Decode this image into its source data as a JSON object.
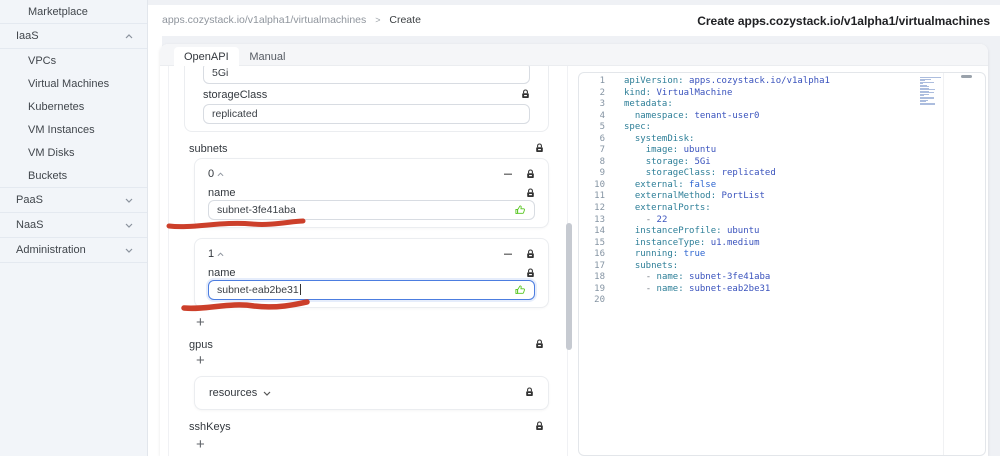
{
  "colors": {
    "focus_border": "#4c7de0",
    "like_green": "#52c41a",
    "annotation_red": "#c9351f",
    "yaml_key": "#2e7f98",
    "yaml_value": "#3a53bd",
    "yaml_boolean": "#2f66d0"
  },
  "icons": {
    "back": "arrow-left",
    "lock": "padlock",
    "like": "thumbs-up",
    "remove": "minus",
    "add": "plus",
    "expanded": "chevron-up",
    "collapsed": "chevron-down"
  },
  "sidebar": {
    "items": [
      {
        "label": "Marketplace",
        "level": 1,
        "chevron": null,
        "divider_after": true
      },
      {
        "label": "IaaS",
        "level": 0,
        "chevron": "up",
        "divider_after": true
      },
      {
        "label": "VPCs",
        "level": 1,
        "chevron": null,
        "divider_after": false
      },
      {
        "label": "Virtual Machines",
        "level": 1,
        "chevron": null,
        "divider_after": false
      },
      {
        "label": "Kubernetes",
        "level": 1,
        "chevron": null,
        "divider_after": false
      },
      {
        "label": "VM Instances",
        "level": 1,
        "chevron": null,
        "divider_after": false
      },
      {
        "label": "VM Disks",
        "level": 1,
        "chevron": null,
        "divider_after": false
      },
      {
        "label": "Buckets",
        "level": 1,
        "chevron": null,
        "divider_after": true
      },
      {
        "label": "PaaS",
        "level": 0,
        "chevron": "down",
        "divider_after": true
      },
      {
        "label": "NaaS",
        "level": 0,
        "chevron": "down",
        "divider_after": true
      },
      {
        "label": "Administration",
        "level": 0,
        "chevron": "down",
        "divider_after": true
      }
    ]
  },
  "header": {
    "breadcrumb": {
      "path": "apps.cozystack.io/v1alpha1/virtualmachines",
      "separator": ">",
      "current": "Create"
    },
    "back_icon": "←",
    "title": "Create apps.cozystack.io/v1alpha1/virtualmachines"
  },
  "tabs": [
    {
      "label": "OpenAPI",
      "active": true
    },
    {
      "label": "Manual",
      "active": false
    }
  ],
  "form": {
    "clipped_input_value": "5Gi",
    "storage_class": {
      "label": "storageClass",
      "value": "replicated"
    },
    "subnets": {
      "label": "subnets",
      "add_label": "+",
      "items": [
        {
          "index": "0",
          "field_label": "name",
          "value": "subnet-3fe41aba",
          "focused": false
        },
        {
          "index": "1",
          "field_label": "name",
          "value": "subnet-eab2be31",
          "focused": true
        }
      ]
    },
    "gpus": {
      "label": "gpus",
      "add_label": "+"
    },
    "resources": {
      "label": "resources"
    },
    "ssh_keys": {
      "label": "sshKeys",
      "add_label": "+"
    }
  },
  "editor": {
    "language": "yaml",
    "lines": [
      {
        "n": 1,
        "segs": [
          [
            "k",
            "apiVersion:"
          ],
          [
            "p",
            " "
          ],
          [
            "v",
            "apps.cozystack.io/v1alpha1"
          ]
        ]
      },
      {
        "n": 2,
        "segs": [
          [
            "k",
            "kind:"
          ],
          [
            "p",
            " "
          ],
          [
            "v",
            "VirtualMachine"
          ]
        ]
      },
      {
        "n": 3,
        "segs": [
          [
            "k",
            "metadata:"
          ]
        ]
      },
      {
        "n": 4,
        "segs": [
          [
            "p",
            "  "
          ],
          [
            "k",
            "namespace:"
          ],
          [
            "p",
            " "
          ],
          [
            "v",
            "tenant-user0"
          ]
        ]
      },
      {
        "n": 5,
        "segs": [
          [
            "k",
            "spec:"
          ]
        ]
      },
      {
        "n": 6,
        "segs": [
          [
            "p",
            "  "
          ],
          [
            "k",
            "systemDisk:"
          ]
        ]
      },
      {
        "n": 7,
        "segs": [
          [
            "p",
            "    "
          ],
          [
            "k",
            "image:"
          ],
          [
            "p",
            " "
          ],
          [
            "v",
            "ubuntu"
          ]
        ]
      },
      {
        "n": 8,
        "segs": [
          [
            "p",
            "    "
          ],
          [
            "k",
            "storage:"
          ],
          [
            "p",
            " "
          ],
          [
            "v",
            "5Gi"
          ]
        ]
      },
      {
        "n": 9,
        "segs": [
          [
            "p",
            "    "
          ],
          [
            "k",
            "storageClass:"
          ],
          [
            "p",
            " "
          ],
          [
            "v",
            "replicated"
          ]
        ]
      },
      {
        "n": 10,
        "segs": [
          [
            "p",
            "  "
          ],
          [
            "k",
            "external:"
          ],
          [
            "p",
            " "
          ],
          [
            "b",
            "false"
          ]
        ]
      },
      {
        "n": 11,
        "segs": [
          [
            "p",
            "  "
          ],
          [
            "k",
            "externalMethod:"
          ],
          [
            "p",
            " "
          ],
          [
            "v",
            "PortList"
          ]
        ]
      },
      {
        "n": 12,
        "segs": [
          [
            "p",
            "  "
          ],
          [
            "k",
            "externalPorts:"
          ]
        ]
      },
      {
        "n": 13,
        "segs": [
          [
            "p",
            "    "
          ],
          [
            "d",
            "- "
          ],
          [
            "v",
            "22"
          ]
        ]
      },
      {
        "n": 14,
        "segs": [
          [
            "p",
            "  "
          ],
          [
            "k",
            "instanceProfile:"
          ],
          [
            "p",
            " "
          ],
          [
            "v",
            "ubuntu"
          ]
        ]
      },
      {
        "n": 15,
        "segs": [
          [
            "p",
            "  "
          ],
          [
            "k",
            "instanceType:"
          ],
          [
            "p",
            " "
          ],
          [
            "v",
            "u1.medium"
          ]
        ]
      },
      {
        "n": 16,
        "segs": [
          [
            "p",
            "  "
          ],
          [
            "k",
            "running:"
          ],
          [
            "p",
            " "
          ],
          [
            "b",
            "true"
          ]
        ]
      },
      {
        "n": 17,
        "segs": [
          [
            "p",
            "  "
          ],
          [
            "k",
            "subnets:"
          ]
        ]
      },
      {
        "n": 18,
        "segs": [
          [
            "p",
            "    "
          ],
          [
            "d",
            "- "
          ],
          [
            "k",
            "name:"
          ],
          [
            "p",
            " "
          ],
          [
            "v",
            "subnet-3fe41aba"
          ]
        ]
      },
      {
        "n": 19,
        "segs": [
          [
            "p",
            "    "
          ],
          [
            "d",
            "- "
          ],
          [
            "k",
            "name:"
          ],
          [
            "p",
            " "
          ],
          [
            "v",
            "subnet-eab2be31"
          ]
        ]
      },
      {
        "n": 20,
        "segs": []
      }
    ]
  }
}
